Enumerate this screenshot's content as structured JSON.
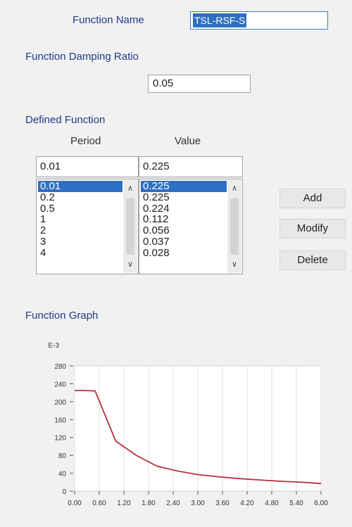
{
  "function_name": {
    "label": "Function Name",
    "value": "TSL-RSF-S"
  },
  "damping": {
    "label": "Function Damping Ratio",
    "value": "0.05"
  },
  "defined_function": {
    "title": "Defined Function",
    "period_header": "Period",
    "value_header": "Value",
    "period_input": "0.01",
    "value_input": "0.225",
    "periods": [
      "0.01",
      "0.2",
      "0.5",
      "1",
      "2",
      "3",
      "4"
    ],
    "values": [
      "0.225",
      "0.225",
      "0.224",
      "0.112",
      "0.056",
      "0.037",
      "0.028"
    ],
    "selected_index": 0
  },
  "buttons": {
    "add": "Add",
    "modify": "Modify",
    "delete": "Delete"
  },
  "graph": {
    "title": "Function Graph"
  },
  "chart_data": {
    "type": "line",
    "ylabel": "E-3",
    "xlim": [
      0,
      6
    ],
    "ylim": [
      0,
      280
    ],
    "x_ticks": [
      "0.00",
      "0.60",
      "1.20",
      "1.80",
      "2.40",
      "3.00",
      "3.60",
      "4.20",
      "4.80",
      "5.40",
      "6.00"
    ],
    "y_ticks": [
      "0",
      "40",
      "80",
      "120",
      "160",
      "200",
      "240",
      "280"
    ],
    "grid": true,
    "color": "#b5303f",
    "x": [
      0,
      0.2,
      0.5,
      1,
      1.5,
      2,
      2.5,
      3,
      3.5,
      4,
      4.5,
      5,
      5.5,
      6
    ],
    "y": [
      225,
      225,
      224,
      112,
      80,
      56,
      45,
      37,
      32,
      28,
      25,
      22,
      20,
      17
    ]
  }
}
